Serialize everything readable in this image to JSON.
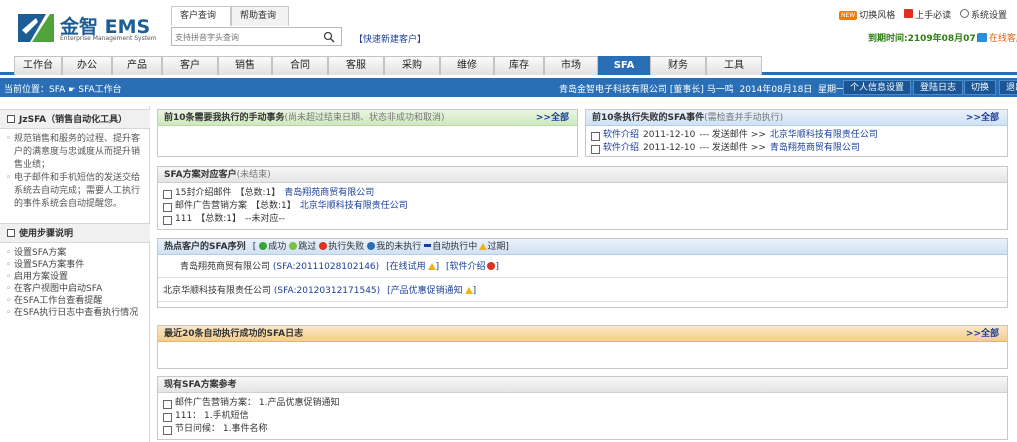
{
  "header": {
    "logo_name": "金智 EMS",
    "logo_sub": "Enterprise Management System",
    "search_tabs": [
      "客户查询",
      "帮助查询"
    ],
    "search_placeholder": "支持拼音字头查询",
    "quick_new": "【快速新建客户】",
    "new_badge": "NEW",
    "links": [
      "切换风格",
      "上手必读",
      "系统设置"
    ],
    "expire_text": "到期时间:2109年08月07日",
    "online_service": "在线客服"
  },
  "nav": {
    "tabs": [
      "工作台",
      "办公",
      "产品",
      "客户",
      "销售",
      "合同",
      "客服",
      "采购",
      "维修",
      "库存",
      "市场",
      "SFA",
      "财务",
      "工具"
    ],
    "active": "SFA"
  },
  "crumb": {
    "label": "当前位置：",
    "path": [
      "SFA",
      "SFA工作台"
    ],
    "company": "青岛金智电子科技有限公司 [董事长] 马一鸣",
    "date": "2014年08月18日",
    "weekday": "星期一",
    "buttons": [
      "个人信息设置",
      "登陆日志",
      "切换",
      "退出"
    ]
  },
  "sidebar": {
    "section1_title": "JzSFA（销售自动化工具）",
    "section1_desc": [
      "规范销售和服务的过程、提升客户的满意度与忠诚度从而提升销售业绩；",
      "电子邮件和手机短信的发送交给系统去自动完成；需要人工执行的事件系统会自动提醒您。"
    ],
    "section2_title": "使用步骤说明",
    "steps": [
      "设置SFA方案",
      "设置SFA方案事件",
      "启用方案设置",
      "在客户视图中启动SFA",
      "在SFA工作台查看提醒",
      "在SFA执行日志中查看执行情况"
    ]
  },
  "panels": {
    "manual": {
      "title": "前10条需要我执行的手动事务",
      "note": "(尚未超过结束日期、状态非成功和取消)",
      "more": ">>全部"
    },
    "failed": {
      "title": "前10条执行失败的SFA事件",
      "note": "(需检查并手动执行)",
      "more": ">>全部",
      "rows": [
        {
          "event": "软件介绍",
          "date": "2011-12-10",
          "action": "--- 发送邮件 >>",
          "company": "北京华顺科技有限责任公司"
        },
        {
          "event": "软件介绍",
          "date": "2011-12-10",
          "action": "--- 发送邮件 >>",
          "company": "青岛翔苑商贸有限公司"
        }
      ]
    },
    "plan_customers": {
      "title": "SFA方案对应客户",
      "note": "(未结束)",
      "rows": [
        {
          "plan": "15封介绍邮件",
          "total": "【总数:1】",
          "target": "青岛翔苑商贸有限公司",
          "link": true
        },
        {
          "plan": "邮件广告营销方案",
          "total": "【总数:1】",
          "target": "北京华顺科技有限责任公司",
          "link": true
        },
        {
          "plan": "111",
          "total": "【总数:1】",
          "target": "--未对应--",
          "link": false
        }
      ]
    },
    "hot": {
      "title": "热点客户的SFA序列",
      "legend": [
        "成功",
        "跳过",
        "执行失败",
        "我的未执行",
        "自动执行中",
        "过期"
      ],
      "rows": [
        {
          "company": "青岛翔苑商贸有限公司",
          "code": "(SFA:20111028102146)",
          "tags": [
            "[在线试用",
            "]",
            "[软件介绍",
            "]"
          ]
        },
        {
          "company": "北京华顺科技有限责任公司",
          "code": "(SFA:20120312171545)",
          "tags": [
            "[产品优惠促销通知",
            "]"
          ]
        }
      ]
    },
    "log": {
      "title": "最近20条自动执行成功的SFA日志",
      "more": ">>全部"
    },
    "existing": {
      "title": "现有SFA方案参考",
      "rows": [
        "邮件广告营销方案：  1.产品优惠促销通知",
        "111：  1.手机短信",
        "节日问候：  1.事件名称"
      ]
    }
  },
  "colors": {
    "brand_blue": "#2a6fb5",
    "link_blue": "#1a3f9a",
    "expire_green": "#2e7d14",
    "orange": "#e0620c"
  }
}
